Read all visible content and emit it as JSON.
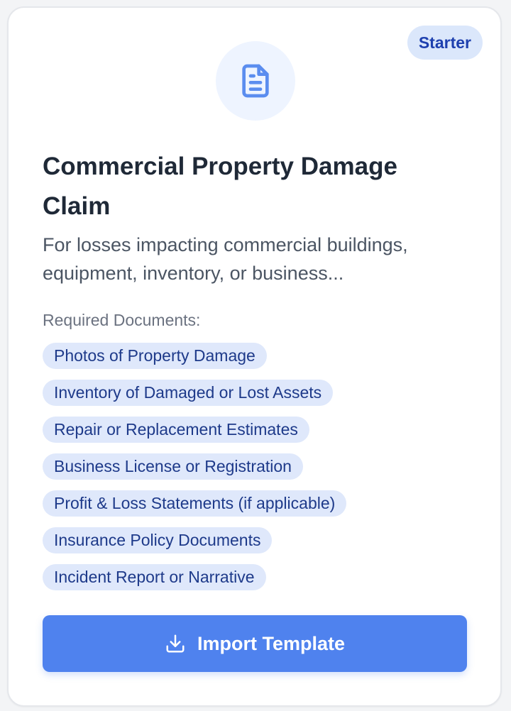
{
  "card": {
    "badge": "Starter",
    "icon": "document-icon",
    "title": "Commercial Property Damage Claim",
    "description": "For losses impacting commercial buildings, equipment, inventory, or business...",
    "required_label": "Required Documents:",
    "documents": [
      "Photos of Property Damage",
      "Inventory of Damaged or Lost Assets",
      "Repair or Replacement Estimates",
      "Business License or Registration",
      "Profit & Loss Statements (if applicable)",
      "Insurance Policy Documents",
      "Incident Report or Narrative"
    ],
    "button": {
      "label": "Import Template",
      "icon": "download-icon"
    }
  },
  "colors": {
    "accent": "#4f82ee",
    "badge_bg": "#dbe7fb",
    "badge_text": "#1e40af",
    "tag_bg": "#dfe8fb",
    "tag_text": "#1e3a8a"
  }
}
